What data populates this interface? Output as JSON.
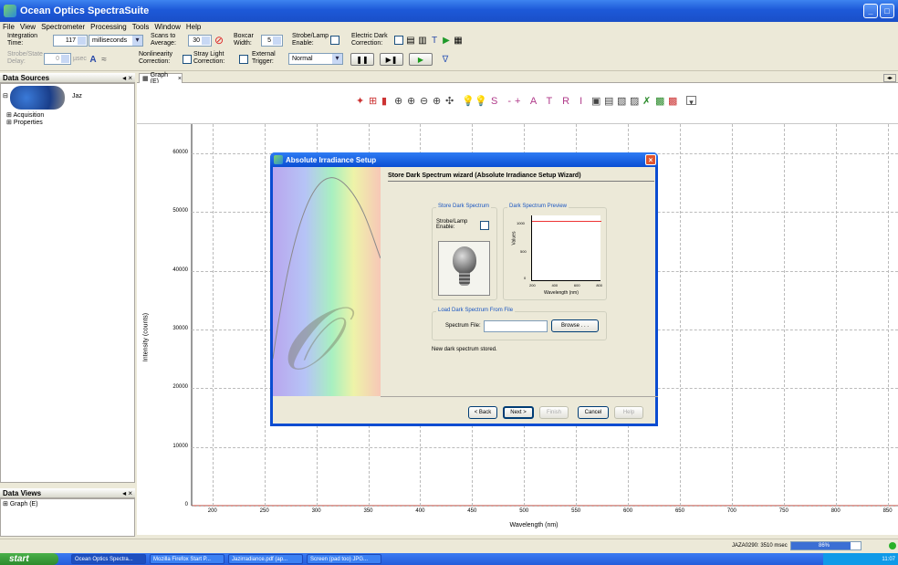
{
  "window": {
    "title": "Ocean Optics SpectraSuite"
  },
  "menu": [
    "File",
    "View",
    "Spectrometer",
    "Processing",
    "Tools",
    "Window",
    "Help"
  ],
  "toolbar": {
    "integration_label": "Integration Time:",
    "integration_value": "117",
    "integration_unit": "milliseconds",
    "scans_label": "Scans to Average:",
    "scans_value": "30",
    "boxcar_label": "Boxcar Width:",
    "boxcar_value": "5",
    "strobe_label": "Strobe/Lamp Enable:",
    "electric_dark_label": "Electric Dark Correction:",
    "strobe_delay_label": "Strobe/State Delay:",
    "strobe_delay_value": "0",
    "strobe_delay_unit": "µsec",
    "nonlinearity_label": "Nonlinearity Correction:",
    "stray_light_label": "Stray Light Correction:",
    "external_trigger_label": "External Trigger:",
    "trigger_mode": "Normal"
  },
  "data_sources": {
    "title": "Data Sources",
    "device": "Jaz",
    "items": [
      "Acquisition",
      "Properties"
    ]
  },
  "data_views": {
    "title": "Data Views",
    "items": [
      "Graph (E)"
    ]
  },
  "graph_tab": {
    "label": "Graph (E)",
    "toolbar_text": "S -+ A T R I"
  },
  "chart_data": {
    "type": "line",
    "xlabel": "Wavelength (nm)",
    "ylabel": "Intensity (counts)",
    "x_ticks": [
      200,
      250,
      300,
      350,
      400,
      450,
      500,
      550,
      600,
      650,
      700,
      750,
      800,
      850
    ],
    "y_ticks": [
      0,
      10000,
      20000,
      30000,
      40000,
      50000,
      60000
    ],
    "xlim": [
      180,
      860
    ],
    "ylim": [
      0,
      65000
    ],
    "series": [
      {
        "x": [
          180,
          860
        ],
        "values": [
          0,
          0
        ],
        "color": "#c0392b"
      }
    ]
  },
  "dialog": {
    "title": "Absolute Irradiance Setup",
    "heading": "Store Dark Spectrum wizard (Absolute Irradiance Setup Wizard)",
    "store_group": "Store Dark Spectrum",
    "strobe_enable": "Strobe/Lamp Enable:",
    "preview_group": "Dark Spectrum Preview",
    "preview_xlabel": "Wavelength (nm)",
    "preview_ylabel": "Values",
    "preview_yticks": [
      "1000",
      "500",
      "0"
    ],
    "preview_xticks": [
      "200",
      "400",
      "600",
      "800"
    ],
    "load_group": "Load Dark Spectrum From File",
    "file_label": "Spectrum File:",
    "file_value": "",
    "browse": "Browse . . .",
    "message": "New dark spectrum stored.",
    "buttons": {
      "back": "< Back",
      "next": "Next >",
      "finish": "Finish",
      "cancel": "Cancel",
      "help": "Help"
    }
  },
  "status": {
    "text": "JAZA0290: 3510 msec",
    "progress_text": "86%",
    "progress": 0.86
  },
  "taskbar": {
    "start": "start",
    "tasks": [
      "Ocean Optics Spectra...",
      "Mozilla Firefox Start P...",
      "Jazirradiance.pdf (ap...",
      "Screen (pad too) JPG..."
    ],
    "clock": "11:07"
  }
}
